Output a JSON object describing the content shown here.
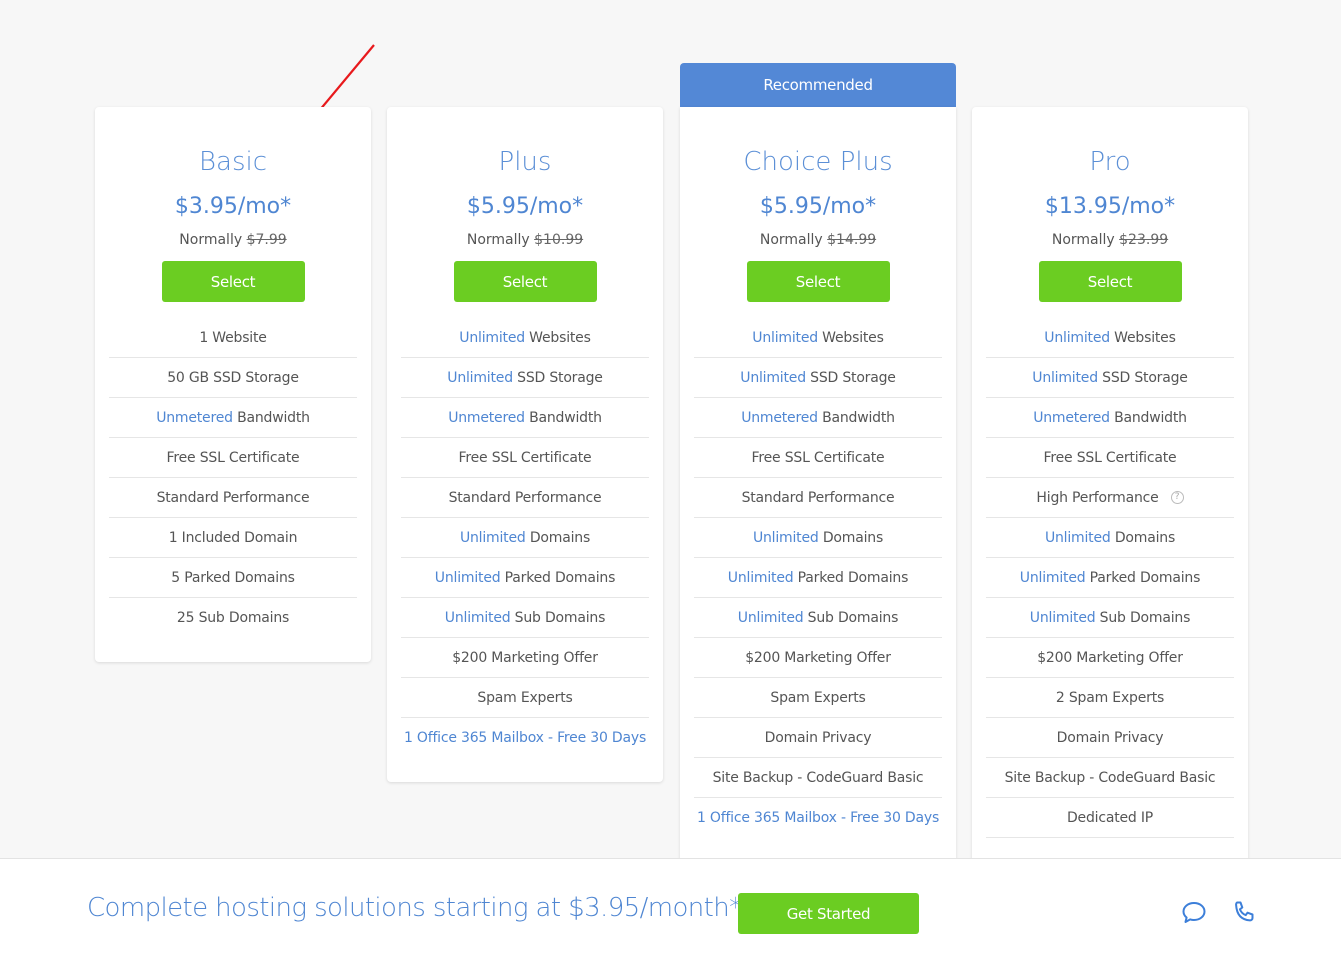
{
  "recommended_label": "Recommended",
  "colors": {
    "accent_blue": "#4f86d2",
    "ribbon_blue": "#5388d6",
    "button_green": "#6bcd22",
    "annotation_arrow": "#e8191c"
  },
  "plans": [
    {
      "name": "Basic",
      "price": "$3.95/mo*",
      "normally_label": "Normally",
      "normal_price": "$7.99",
      "select_label": "Select",
      "features": [
        {
          "hl": "",
          "text": "1 Website"
        },
        {
          "hl": "",
          "text": "50 GB SSD Storage"
        },
        {
          "hl": "Unmetered",
          "text": " Bandwidth"
        },
        {
          "hl": "",
          "text": "Free SSL Certificate"
        },
        {
          "hl": "",
          "text": "Standard Performance"
        },
        {
          "hl": "",
          "text": "1 Included Domain"
        },
        {
          "hl": "",
          "text": "5 Parked Domains"
        },
        {
          "hl": "",
          "text": "25 Sub Domains"
        }
      ]
    },
    {
      "name": "Plus",
      "price": "$5.95/mo*",
      "normally_label": "Normally",
      "normal_price": "$10.99",
      "select_label": "Select",
      "features": [
        {
          "hl": "Unlimited",
          "text": " Websites"
        },
        {
          "hl": "Unlimited",
          "text": " SSD Storage"
        },
        {
          "hl": "Unmetered",
          "text": " Bandwidth"
        },
        {
          "hl": "",
          "text": "Free SSL Certificate"
        },
        {
          "hl": "",
          "text": "Standard Performance"
        },
        {
          "hl": "Unlimited",
          "text": " Domains"
        },
        {
          "hl": "Unlimited",
          "text": " Parked Domains"
        },
        {
          "hl": "Unlimited",
          "text": " Sub Domains"
        },
        {
          "hl": "",
          "text": "$200 Marketing Offer"
        },
        {
          "hl": "",
          "text": "Spam Experts"
        },
        {
          "hl": "1 Office 365 Mailbox - Free 30 Days",
          "text": ""
        }
      ]
    },
    {
      "name": "Choice Plus",
      "price": "$5.95/mo*",
      "normally_label": "Normally",
      "normal_price": "$14.99",
      "select_label": "Select",
      "features": [
        {
          "hl": "Unlimited",
          "text": " Websites"
        },
        {
          "hl": "Unlimited",
          "text": " SSD Storage"
        },
        {
          "hl": "Unmetered",
          "text": " Bandwidth"
        },
        {
          "hl": "",
          "text": "Free SSL Certificate"
        },
        {
          "hl": "",
          "text": "Standard Performance"
        },
        {
          "hl": "Unlimited",
          "text": " Domains"
        },
        {
          "hl": "Unlimited",
          "text": " Parked Domains"
        },
        {
          "hl": "Unlimited",
          "text": " Sub Domains"
        },
        {
          "hl": "",
          "text": "$200 Marketing Offer"
        },
        {
          "hl": "",
          "text": "Spam Experts"
        },
        {
          "hl": "",
          "text": "Domain Privacy"
        },
        {
          "hl": "",
          "text": "Site Backup - CodeGuard Basic"
        },
        {
          "hl": "1 Office 365 Mailbox - Free 30 Days",
          "text": ""
        }
      ]
    },
    {
      "name": "Pro",
      "price": "$13.95/mo*",
      "normally_label": "Normally",
      "normal_price": "$23.99",
      "select_label": "Select",
      "features": [
        {
          "hl": "Unlimited",
          "text": " Websites"
        },
        {
          "hl": "Unlimited",
          "text": " SSD Storage"
        },
        {
          "hl": "Unmetered",
          "text": " Bandwidth"
        },
        {
          "hl": "",
          "text": "Free SSL Certificate"
        },
        {
          "hl": "",
          "text": "High Performance",
          "help": "?"
        },
        {
          "hl": "Unlimited",
          "text": " Domains"
        },
        {
          "hl": "Unlimited",
          "text": " Parked Domains"
        },
        {
          "hl": "Unlimited",
          "text": " Sub Domains"
        },
        {
          "hl": "",
          "text": "$200 Marketing Offer"
        },
        {
          "hl": "",
          "text": "2 Spam Experts"
        },
        {
          "hl": "",
          "text": "Domain Privacy"
        },
        {
          "hl": "",
          "text": "Site Backup - CodeGuard Basic"
        },
        {
          "hl": "",
          "text": "Dedicated IP"
        },
        {
          "hl": "",
          "text": ""
        }
      ]
    }
  ],
  "footer": {
    "tagline": "Complete hosting solutions starting at $3.95/month*",
    "cta_label": "Get Started",
    "icons": [
      "chat-icon",
      "phone-icon"
    ]
  }
}
